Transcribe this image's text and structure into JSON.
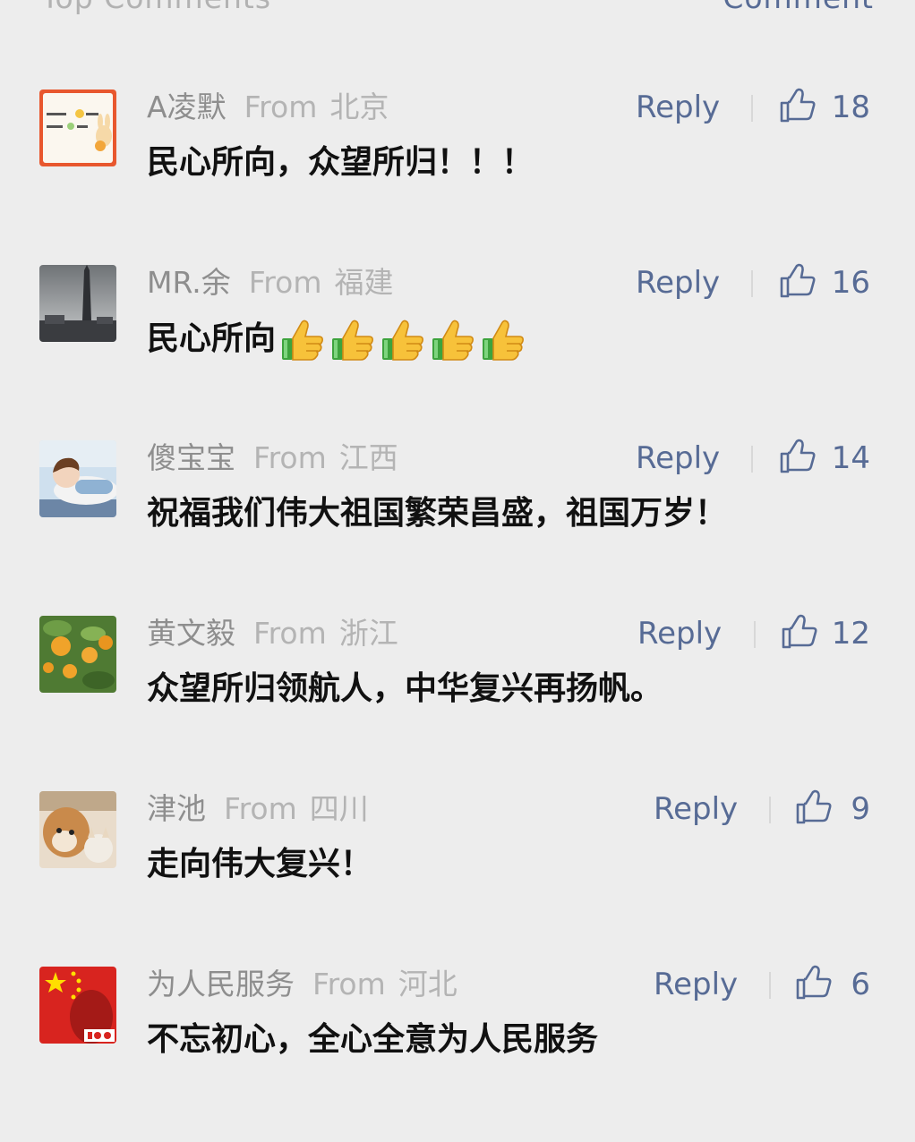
{
  "header": {
    "title": "Top Comments",
    "action": "Comment"
  },
  "labels": {
    "from": "From",
    "reply": "Reply"
  },
  "colors": {
    "background": "#ededed",
    "link": "#576b95",
    "name": "#8e8e8e",
    "text": "#111111"
  },
  "comments": [
    {
      "name": "A凌默",
      "location": "北京",
      "likes": "18",
      "text": "民心所向，众望所归！！！",
      "avatar": "sun-rabbit-card-avatar"
    },
    {
      "name": "MR.余",
      "location": "福建",
      "likes": "16",
      "text": "民心所向",
      "emoji_count": 5,
      "emoji": "thumbs-up-emoji",
      "avatar": "obelisk-photo-avatar"
    },
    {
      "name": "傻宝宝",
      "location": "江西",
      "likes": "14",
      "text": "祝福我们伟大祖国繁荣昌盛，祖国万岁！",
      "avatar": "sleeping-cartoon-avatar"
    },
    {
      "name": "黄文毅",
      "location": "浙江",
      "likes": "12",
      "text": "众望所归领航人，中华复兴再扬帆。",
      "avatar": "orange-tree-avatar"
    },
    {
      "name": "津池",
      "location": "四川",
      "likes": "9",
      "text": "走向伟大复兴！",
      "avatar": "dog-cat-avatar"
    },
    {
      "name": "为人民服务",
      "location": "河北",
      "likes": "6",
      "text": "不忘初心，全心全意为人民服务",
      "avatar": "flag-100-avatar"
    }
  ]
}
